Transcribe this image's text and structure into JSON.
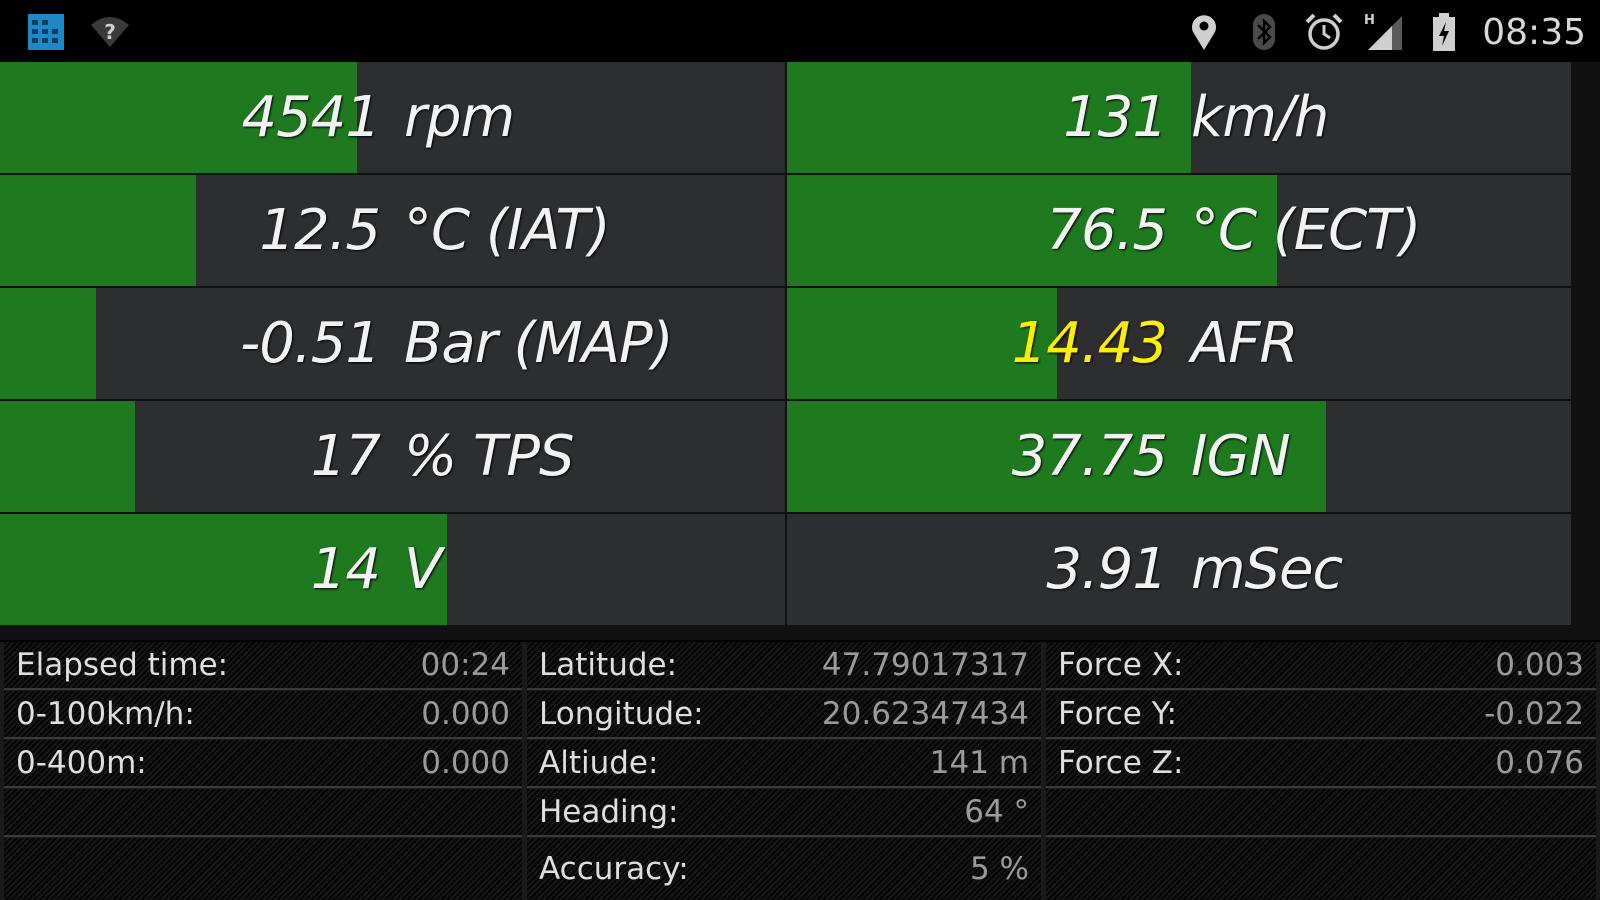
{
  "status_bar": {
    "time": "08:35",
    "left_icons": [
      "app-grid-icon",
      "wifi-question-icon"
    ],
    "right_icons": [
      "location-icon",
      "bluetooth-icon",
      "alarm-icon",
      "signal-h-icon",
      "battery-charging-icon"
    ]
  },
  "gauges": [
    {
      "value": "4541",
      "unit": "rpm",
      "fill": 0.455,
      "value_color": "#f2f2f2"
    },
    {
      "value": "131",
      "unit": "km/h",
      "fill": 0.515,
      "value_color": "#f2f2f2"
    },
    {
      "value": "12.5",
      "unit": "°C (IAT)",
      "fill": 0.25,
      "value_color": "#f2f2f2"
    },
    {
      "value": "76.5",
      "unit": "°C (ECT)",
      "fill": 0.625,
      "value_color": "#f2f2f2"
    },
    {
      "value": "-0.51",
      "unit": "Bar (MAP)",
      "fill": 0.122,
      "value_color": "#f2f2f2"
    },
    {
      "value": "14.43",
      "unit": "AFR",
      "fill": 0.345,
      "value_color": "#ffee00"
    },
    {
      "value": "17",
      "unit": "% TPS",
      "fill": 0.172,
      "value_color": "#f2f2f2"
    },
    {
      "value": "37.75",
      "unit": "IGN",
      "fill": 0.688,
      "value_color": "#f2f2f2"
    },
    {
      "value": "14",
      "unit": "V",
      "fill": 0.57,
      "value_color": "#f2f2f2"
    },
    {
      "value": "3.91",
      "unit": "mSec",
      "fill": 0.0,
      "value_color": "#f2f2f2"
    }
  ],
  "info": {
    "timing": [
      {
        "label": "Elapsed time:",
        "value": "00:24"
      },
      {
        "label": "0-100km/h:",
        "value": "0.000"
      },
      {
        "label": "0-400m:",
        "value": "0.000"
      },
      {
        "label": "",
        "value": ""
      },
      {
        "label": "",
        "value": ""
      }
    ],
    "gps": [
      {
        "label": "Latitude:",
        "value": "47.79017317"
      },
      {
        "label": "Longitude:",
        "value": "20.62347434"
      },
      {
        "label": "Altiude:",
        "value": "141 m"
      },
      {
        "label": "Heading:",
        "value": "64 °"
      },
      {
        "label": "Accuracy:",
        "value": "5 %"
      }
    ],
    "force": [
      {
        "label": "Force X:",
        "value": "0.003"
      },
      {
        "label": "Force Y:",
        "value": "-0.022"
      },
      {
        "label": "Force Z:",
        "value": "0.076"
      },
      {
        "label": "",
        "value": ""
      },
      {
        "label": "",
        "value": ""
      }
    ]
  },
  "colors": {
    "gauge_fill": "#1f7a1f",
    "gauge_bg": "#2d2e30",
    "highlight": "#ffee00"
  }
}
